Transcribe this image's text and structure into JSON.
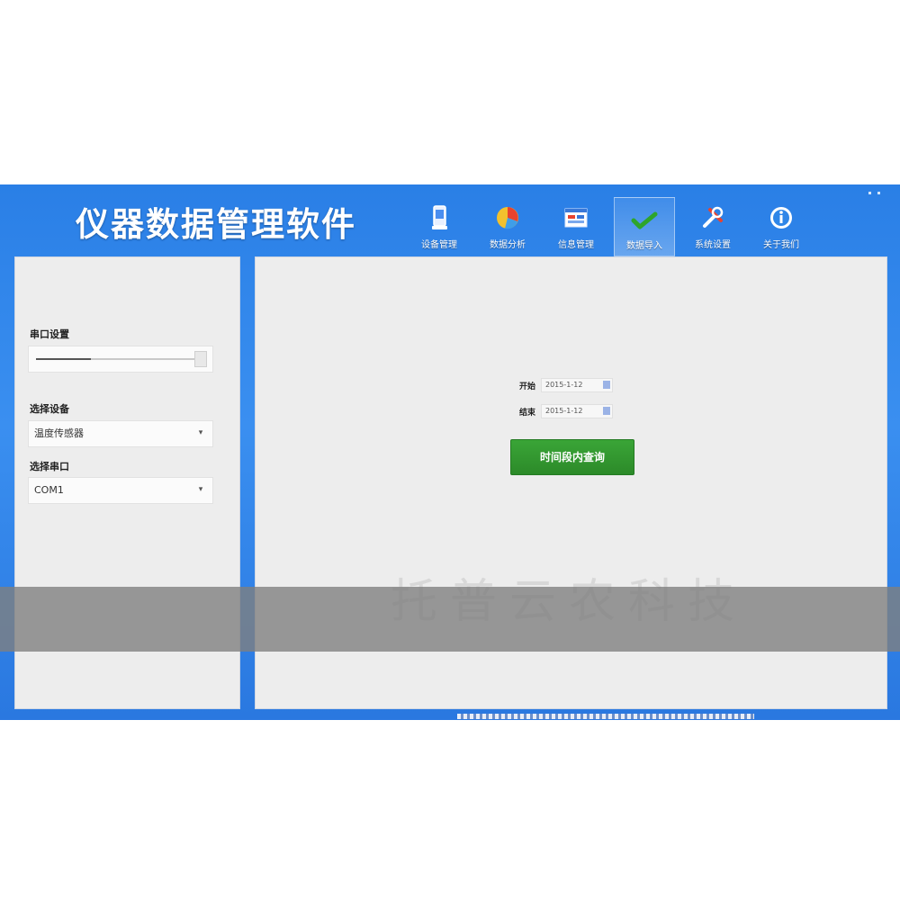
{
  "app": {
    "title": "仪器数据管理软件"
  },
  "toolbar": [
    {
      "label": "设备管理",
      "icon": "device-icon"
    },
    {
      "label": "数据分析",
      "icon": "pie-chart-icon"
    },
    {
      "label": "信息管理",
      "icon": "window-icon"
    },
    {
      "label": "数据导入",
      "icon": "checkmark-icon",
      "active": true
    },
    {
      "label": "系统设置",
      "icon": "tools-icon"
    },
    {
      "label": "关于我们",
      "icon": "info-icon"
    }
  ],
  "left": {
    "slider_label": "串口设置",
    "slider_value": 0.34,
    "select1_label": "选择设备",
    "select1_value": "温度传感器",
    "select2_label": "选择串口",
    "select2_value": "COM1"
  },
  "main": {
    "start_label": "开始",
    "start_value": "2015-1-12",
    "end_label": "结束",
    "end_value": "2015-1-12",
    "import_button": "时间段内查询",
    "watermark": "托普云农科技"
  },
  "colors": {
    "frame": "#2f7fe0",
    "panel": "#ededed",
    "button": "#2c8a29"
  }
}
